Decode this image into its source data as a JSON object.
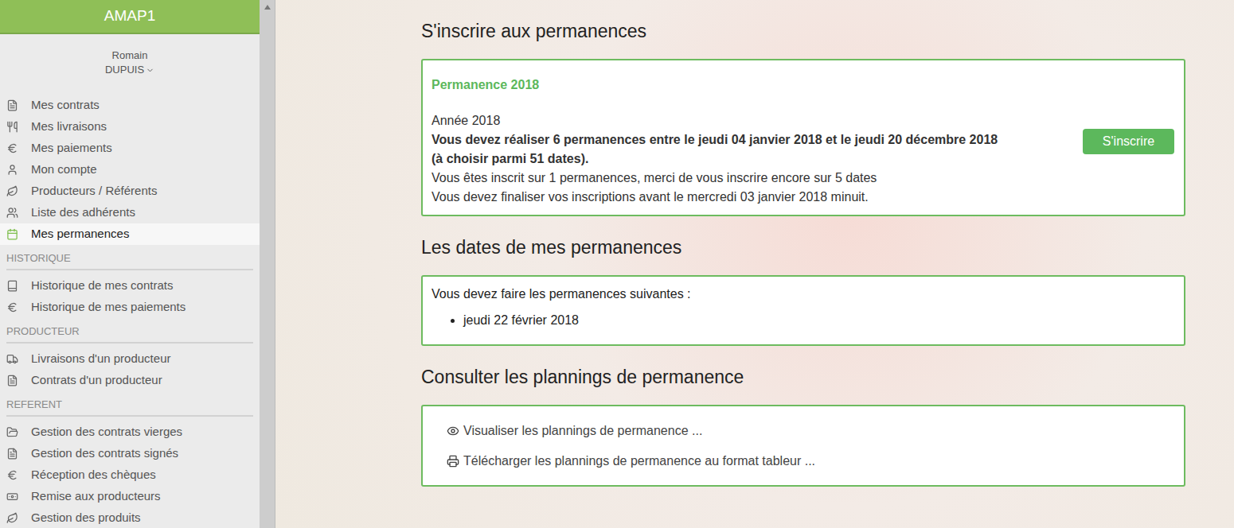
{
  "sidebar": {
    "title": "AMAP1",
    "user": {
      "first_name": "Romain",
      "last_name": "DUPUIS"
    },
    "menu": [
      {
        "label": "Mes contrats",
        "selected": false
      },
      {
        "label": "Mes livraisons",
        "selected": false
      },
      {
        "label": "Mes paiements",
        "selected": false
      },
      {
        "label": "Mon compte",
        "selected": false
      },
      {
        "label": "Producteurs / Référents",
        "selected": false
      },
      {
        "label": "Liste des adhérents",
        "selected": false
      },
      {
        "label": "Mes permanences",
        "selected": true
      }
    ],
    "sections": [
      {
        "title": "HISTORIQUE",
        "items": [
          {
            "label": "Historique de mes contrats",
            "selected": false
          },
          {
            "label": "Historique de mes paiements",
            "selected": false
          }
        ]
      },
      {
        "title": "PRODUCTEUR",
        "items": [
          {
            "label": "Livraisons d'un producteur",
            "selected": false
          },
          {
            "label": "Contrats d'un producteur",
            "selected": false
          }
        ]
      },
      {
        "title": "REFERENT",
        "items": [
          {
            "label": "Gestion des contrats vierges",
            "selected": false
          },
          {
            "label": "Gestion des contrats signés",
            "selected": false
          },
          {
            "label": "Réception des chèques",
            "selected": false
          },
          {
            "label": "Remise aux producteurs",
            "selected": false
          },
          {
            "label": "Gestion des produits",
            "selected": false
          }
        ]
      }
    ]
  },
  "register": {
    "heading": "S'inscrire aux permanences",
    "card": {
      "title": "Permanence 2018",
      "lines": [
        {
          "text": "Année 2018",
          "bold": false
        },
        {
          "text": "Vous devez réaliser 6 permanences entre le jeudi 04 janvier 2018 et le jeudi 20 décembre 2018",
          "bold": true
        },
        {
          "text": "(à choisir parmi 51 dates).",
          "bold": true
        },
        {
          "text": "Vous êtes inscrit sur 1 permanences, merci de vous inscrire encore sur 5 dates",
          "bold": false
        },
        {
          "text": "Vous devez finaliser vos inscriptions avant le mercredi 03 janvier 2018 minuit.",
          "bold": false
        }
      ],
      "button": "S'inscrire"
    }
  },
  "dates": {
    "heading": "Les dates de mes permanences",
    "intro": "Vous devez faire les permanences suivantes :",
    "items": [
      "jeudi 22 février 2018"
    ]
  },
  "plannings": {
    "heading": "Consulter les plannings de permanence",
    "links": [
      "Visualiser les plannings de permanence ...",
      "Télécharger les plannings de permanence au format tableur ..."
    ]
  }
}
